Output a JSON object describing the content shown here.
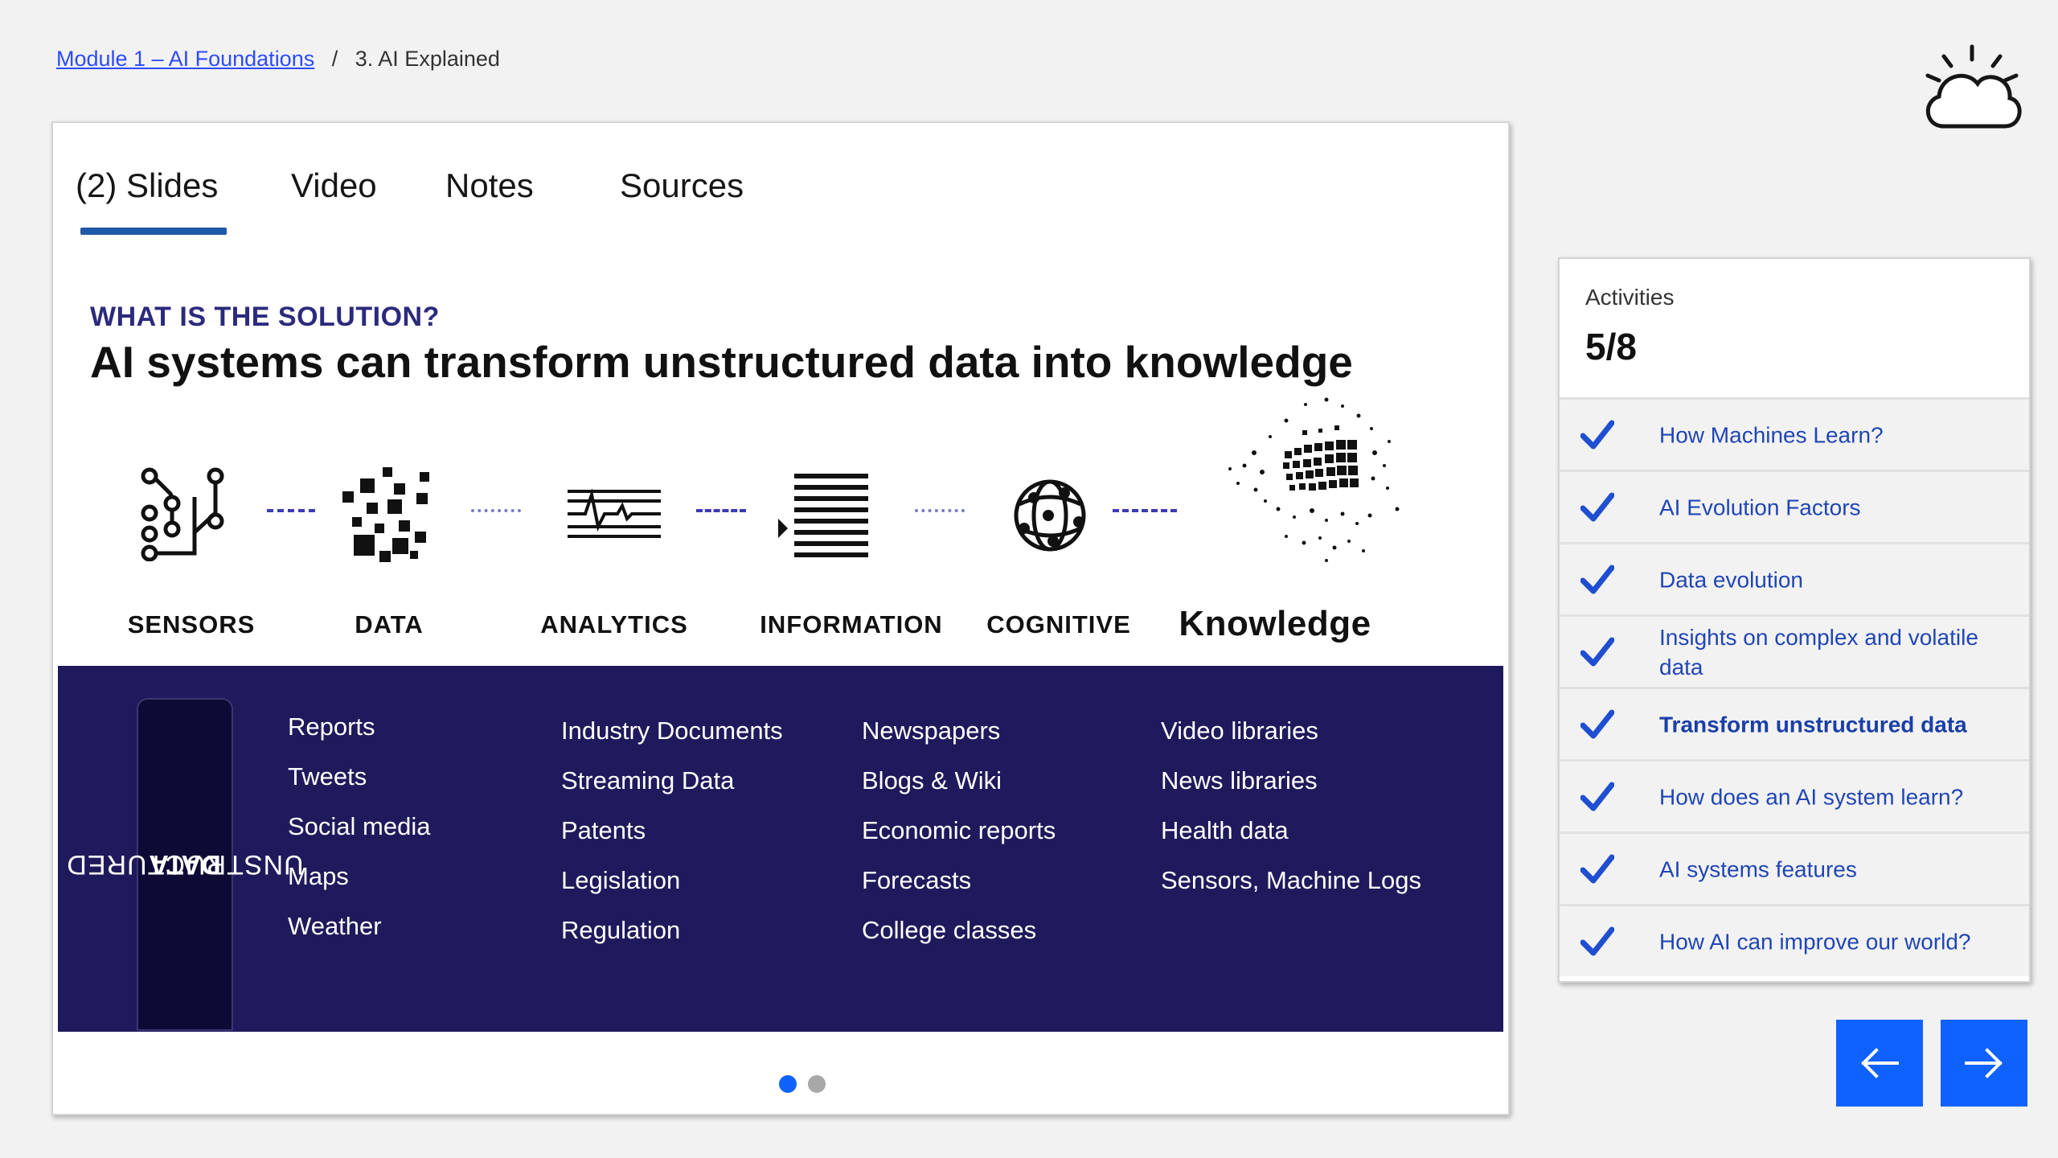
{
  "breadcrumb": {
    "module": "Module 1 – AI Foundations",
    "separator": "/",
    "current": "3. AI Explained"
  },
  "tabs": [
    {
      "label": "(2) Slides",
      "active": true
    },
    {
      "label": "Video"
    },
    {
      "label": "Notes"
    },
    {
      "label": "Sources"
    }
  ],
  "slide": {
    "kicker": "WHAT IS THE SOLUTION?",
    "title": "AI systems can transform unstructured data into knowledge",
    "stages": [
      "SENSORS",
      "DATA",
      "ANALYTICS",
      "INFORMATION",
      "COGNITIVE",
      "Knowledge"
    ],
    "panel": {
      "label_line1": "UNSTRUCTURED",
      "label_line2": "DATA",
      "columns": [
        [
          "Reports",
          "Tweets",
          "Social media",
          "Maps",
          "Weather"
        ],
        [
          "Industry Documents",
          "Streaming Data",
          "Patents",
          "Legislation",
          "Regulation"
        ],
        [
          "Newspapers",
          "Blogs & Wiki",
          "Economic reports",
          "Forecasts",
          "College classes"
        ],
        [
          "Video libraries",
          "News libraries",
          "Health data",
          "Sensors, Machine Logs"
        ]
      ]
    },
    "pager": {
      "total": 2,
      "current": 1
    }
  },
  "activities": {
    "heading": "Activities",
    "progress": "5/8",
    "items": [
      {
        "label": "How Machines Learn?",
        "completed": true
      },
      {
        "label": "AI Evolution Factors",
        "completed": true
      },
      {
        "label": "Data evolution",
        "completed": true
      },
      {
        "label": "Insights on complex and volatile data",
        "completed": true
      },
      {
        "label": "Transform unstructured data",
        "completed": true,
        "active": true
      },
      {
        "label": "How does an AI system learn?",
        "completed": true
      },
      {
        "label": "AI systems features",
        "completed": true
      },
      {
        "label": "How AI can improve our world?",
        "completed": true
      }
    ]
  },
  "icons": {
    "logo": "cloud-sun-icon",
    "check": "checkmark-icon",
    "prev": "arrow-left-icon",
    "next": "arrow-right-icon"
  },
  "colors": {
    "accent_blue": "#0f62fe",
    "tab_underline": "#1f57a9",
    "panel_bg": "#1f1a5c",
    "kicker": "#2c2a7c",
    "link": "#2d4bff"
  }
}
